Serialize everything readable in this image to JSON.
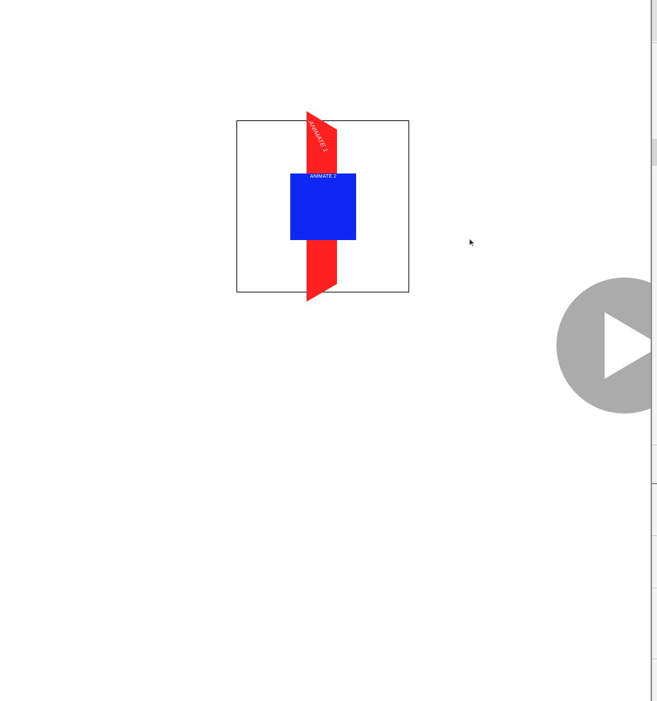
{
  "stage": {
    "red_panel_label": "ANIMATE 1",
    "blue_box_label": "ANIMATE 2"
  },
  "colors": {
    "red": "#ff2020",
    "blue": "#0e27f5",
    "play_button": "#ababab"
  },
  "icons": {
    "cursor": "mouse-pointer-icon",
    "play": "play-icon"
  }
}
